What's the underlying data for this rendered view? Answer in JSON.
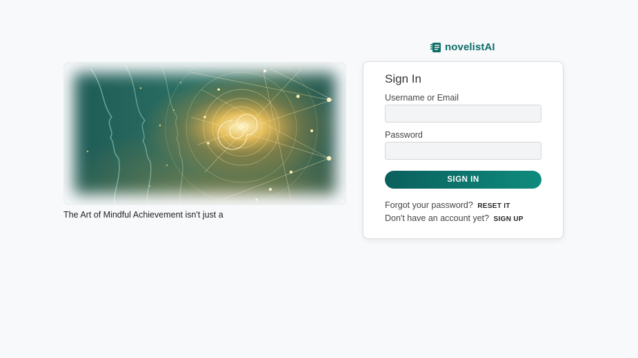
{
  "brand": {
    "name": "novelistAI",
    "accent": "#0d6e68",
    "logo_icon": "book-icon"
  },
  "hero": {
    "image": "sacred-geometry-spiral-illustration",
    "caption": "The Art of Mindful Achievement isn't just a"
  },
  "signin": {
    "title": "Sign In",
    "username_label": "Username or Email",
    "username_value": "",
    "username_placeholder": "",
    "password_label": "Password",
    "password_value": "",
    "password_placeholder": "",
    "submit_label": "SIGN IN",
    "button_color": "#0e7d72"
  },
  "footer_links": {
    "forgot_text": "Forgot your password?",
    "reset_label": "RESET IT",
    "no_account_text": "Don't have an account yet?",
    "signup_label": "SIGN UP"
  }
}
